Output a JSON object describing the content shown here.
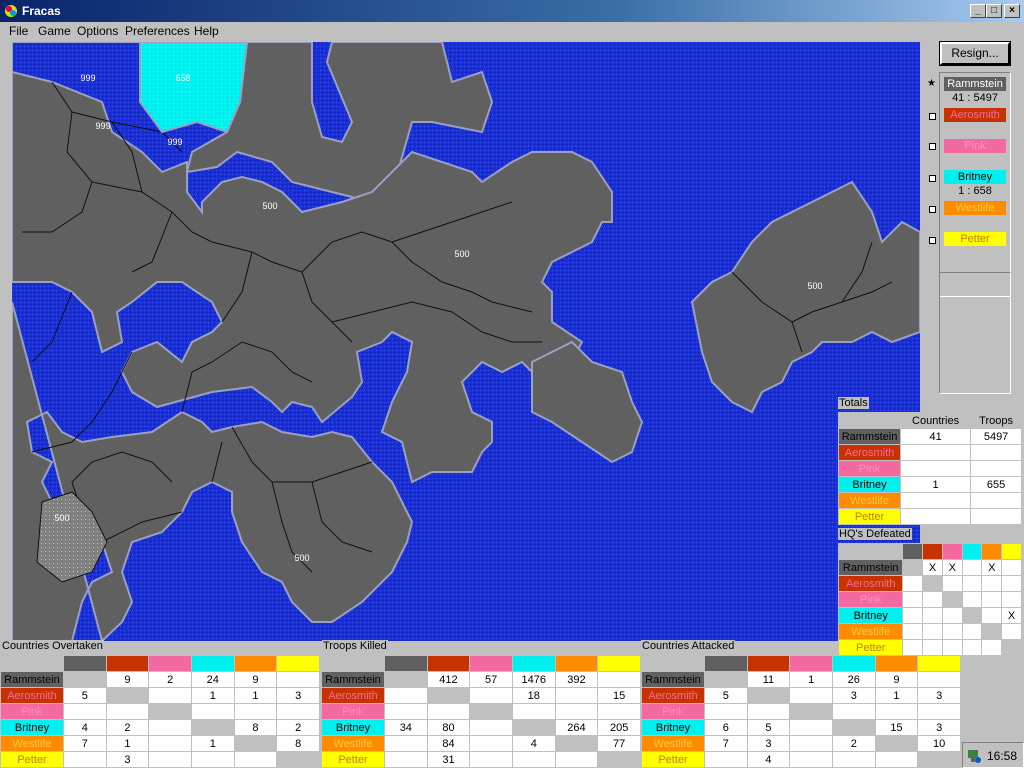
{
  "window": {
    "title": "Fracas",
    "minimize": "_",
    "maximize": "□",
    "close": "×"
  },
  "menu": [
    "File",
    "Game",
    "Options",
    "Preferences",
    "Help"
  ],
  "colors": {
    "Rammstein": "#606060",
    "Aerosmith": "#c83200",
    "Pink": "#f46aa0",
    "Britney": "#00f0f0",
    "Westlife": "#ff8c00",
    "Petter": "#ffff00",
    "sea": "#1a2fd6",
    "land": "#606060"
  },
  "side": {
    "resign_label": "Resign...",
    "players": [
      {
        "name": "Rammstein",
        "count": "41 : 5497",
        "marker": "star-icon"
      },
      {
        "name": "Aerosmith",
        "count": "",
        "marker": "square-icon"
      },
      {
        "name": "Pink",
        "count": "",
        "marker": "square-icon"
      },
      {
        "name": "Britney",
        "count": "1 : 658",
        "marker": "square-icon"
      },
      {
        "name": "Westlife",
        "count": "",
        "marker": "square-icon"
      },
      {
        "name": "Petter",
        "count": "",
        "marker": "square-icon"
      }
    ]
  },
  "map_labels": [
    {
      "text": "999"
    },
    {
      "text": "658"
    },
    {
      "text": "999"
    },
    {
      "text": "999"
    },
    {
      "text": "500"
    },
    {
      "text": "500"
    },
    {
      "text": "500"
    },
    {
      "text": "500"
    },
    {
      "text": "500"
    }
  ],
  "totals": {
    "label": "Totals",
    "headers": [
      "Countries",
      "Troops"
    ],
    "rows": [
      {
        "name": "Rammstein",
        "countries": "41",
        "troops": "5497"
      },
      {
        "name": "Aerosmith",
        "countries": "",
        "troops": ""
      },
      {
        "name": "Pink",
        "countries": "",
        "troops": ""
      },
      {
        "name": "Britney",
        "countries": "1",
        "troops": "655"
      },
      {
        "name": "Westlife",
        "countries": "",
        "troops": ""
      },
      {
        "name": "Petter",
        "countries": "",
        "troops": ""
      }
    ]
  },
  "hqs": {
    "label": "HQ's Defeated",
    "rows": [
      {
        "name": "Rammstein",
        "cells": [
          "",
          "X",
          "X",
          "",
          "X",
          ""
        ]
      },
      {
        "name": "Aerosmith",
        "cells": [
          "",
          "",
          "",
          "",
          "",
          ""
        ]
      },
      {
        "name": "Pink",
        "cells": [
          "",
          "",
          "",
          "",
          "",
          ""
        ]
      },
      {
        "name": "Britney",
        "cells": [
          "",
          "",
          "",
          "",
          "",
          "X"
        ]
      },
      {
        "name": "Westlife",
        "cells": [
          "",
          "",
          "",
          "",
          "",
          ""
        ]
      },
      {
        "name": "Petter",
        "cells": [
          "",
          "",
          "",
          "",
          "",
          ""
        ]
      }
    ]
  },
  "countries_overtaken": {
    "label": "Countries Overtaken",
    "rows": [
      {
        "name": "Rammstein",
        "cells": [
          "",
          "9",
          "2",
          "24",
          "9",
          ""
        ]
      },
      {
        "name": "Aerosmith",
        "cells": [
          "5",
          "",
          "",
          "1",
          "1",
          "3"
        ]
      },
      {
        "name": "Pink",
        "cells": [
          "",
          "",
          "",
          "",
          "",
          ""
        ]
      },
      {
        "name": "Britney",
        "cells": [
          "4",
          "2",
          "",
          "",
          "8",
          "2"
        ]
      },
      {
        "name": "Westlife",
        "cells": [
          "7",
          "1",
          "",
          "1",
          "",
          "8"
        ]
      },
      {
        "name": "Petter",
        "cells": [
          "",
          "3",
          "",
          "",
          "",
          ""
        ]
      }
    ]
  },
  "troops_killed": {
    "label": "Troops Killed",
    "rows": [
      {
        "name": "Rammstein",
        "cells": [
          "",
          "412",
          "57",
          "1476",
          "392",
          ""
        ]
      },
      {
        "name": "Aerosmith",
        "cells": [
          "",
          "",
          "",
          "18",
          "",
          "15"
        ]
      },
      {
        "name": "Pink",
        "cells": [
          "",
          "",
          "",
          "",
          "",
          ""
        ]
      },
      {
        "name": "Britney",
        "cells": [
          "34",
          "80",
          "",
          "",
          "264",
          "205"
        ]
      },
      {
        "name": "Westlife",
        "cells": [
          "",
          "84",
          "",
          "4",
          "",
          "77"
        ]
      },
      {
        "name": "Petter",
        "cells": [
          "",
          "31",
          "",
          "",
          "",
          ""
        ]
      }
    ]
  },
  "countries_attacked": {
    "label": "Countries Attacked",
    "rows": [
      {
        "name": "Rammstein",
        "cells": [
          "",
          "11",
          "1",
          "26",
          "9",
          ""
        ]
      },
      {
        "name": "Aerosmith",
        "cells": [
          "5",
          "",
          "",
          "3",
          "1",
          "3"
        ]
      },
      {
        "name": "Pink",
        "cells": [
          "",
          "",
          "",
          "",
          "",
          ""
        ]
      },
      {
        "name": "Britney",
        "cells": [
          "6",
          "5",
          "",
          "",
          "15",
          "3"
        ]
      },
      {
        "name": "Westlife",
        "cells": [
          "7",
          "3",
          "",
          "2",
          "",
          "10"
        ]
      },
      {
        "name": "Petter",
        "cells": [
          "",
          "4",
          "",
          "",
          "",
          ""
        ]
      }
    ]
  },
  "status": {
    "clock": "16:58"
  }
}
